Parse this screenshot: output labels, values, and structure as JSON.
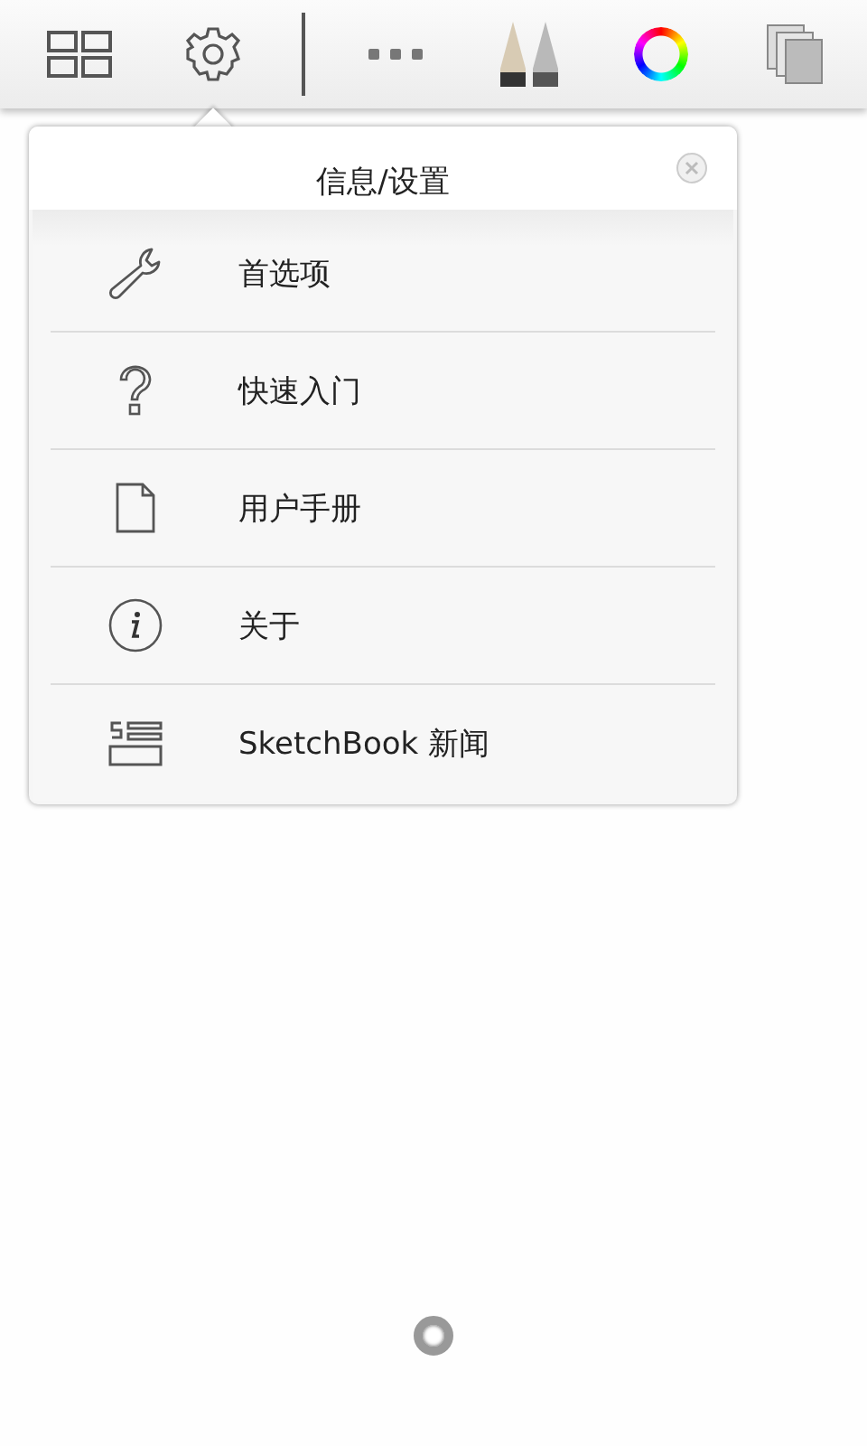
{
  "toolbar": [
    {
      "kind": "gallery"
    },
    {
      "kind": "settings"
    },
    {
      "kind": "divider"
    },
    {
      "kind": "more"
    },
    {
      "kind": "brushes"
    },
    {
      "kind": "color"
    },
    {
      "kind": "layers"
    }
  ],
  "popover": {
    "title": "信息/设置",
    "items": [
      {
        "kind": "wrench",
        "label": "首选项"
      },
      {
        "kind": "question",
        "label": "快速入门"
      },
      {
        "kind": "page",
        "label": "用户手册"
      },
      {
        "kind": "info",
        "label": "关于"
      },
      {
        "kind": "news",
        "label": "SketchBook 新闻"
      }
    ]
  }
}
